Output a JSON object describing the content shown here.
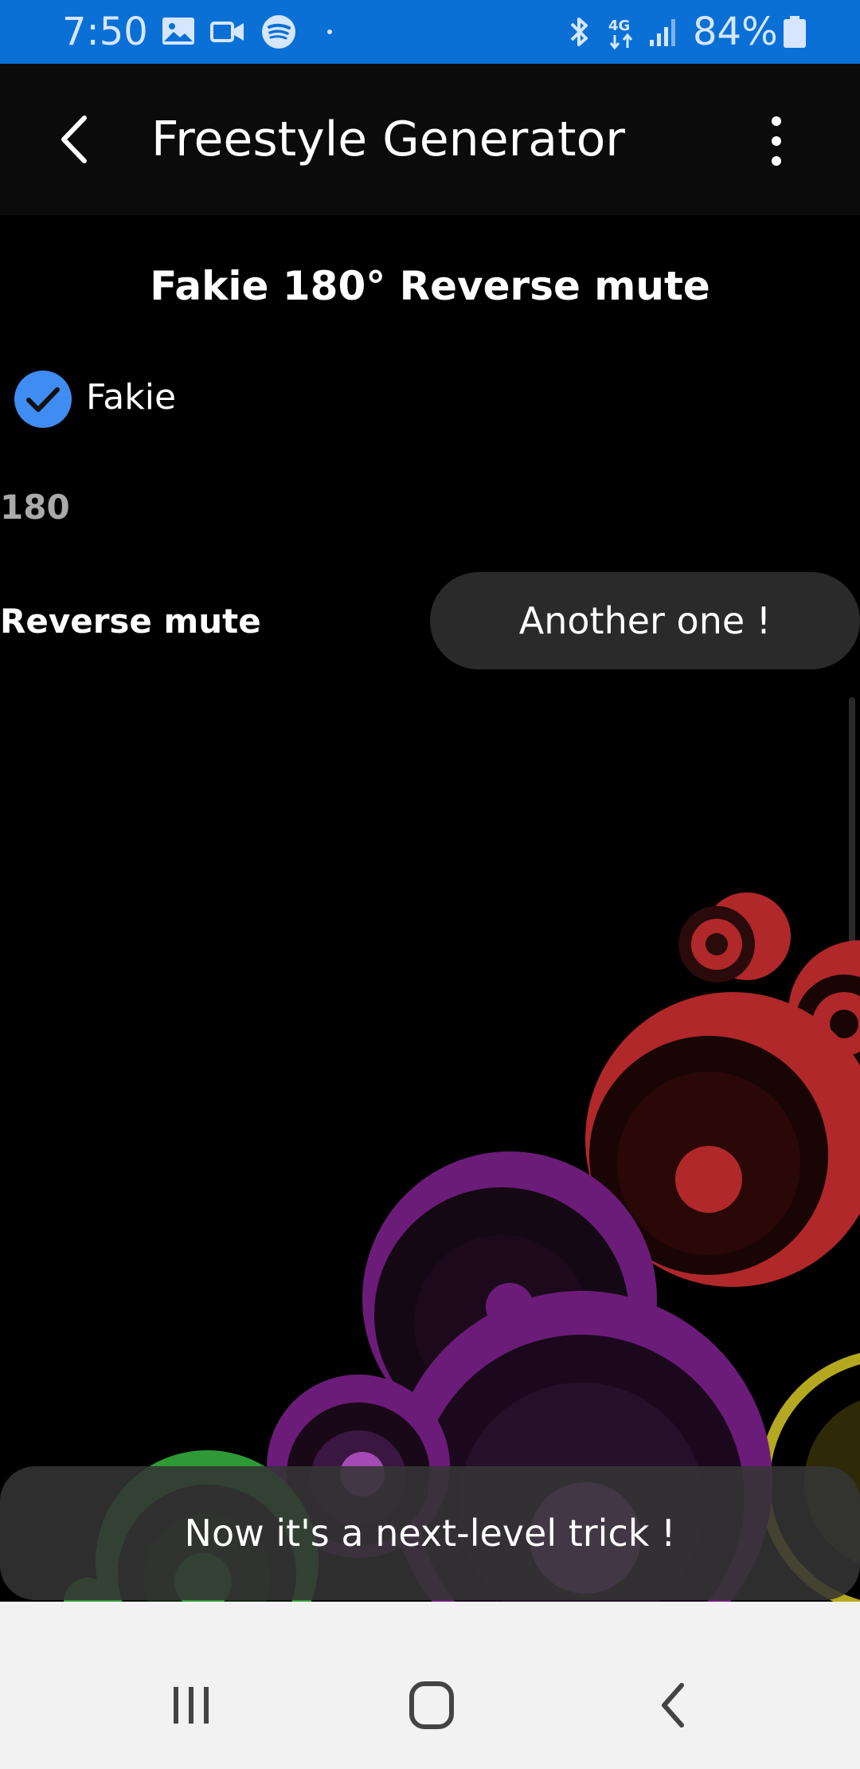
{
  "status_bar": {
    "time": "7:50",
    "battery": "84%",
    "network": "4G",
    "left_icons": [
      "gallery-icon",
      "video-icon",
      "spotify-icon",
      "dot-icon"
    ],
    "right_icons": [
      "bluetooth-icon",
      "network-4g-icon",
      "signal-icon",
      "battery-icon"
    ],
    "background_color": "#0a70d6"
  },
  "app_bar": {
    "title": "Freestyle Generator",
    "back_icon": "back-arrow-icon",
    "menu_icon": "more-vert-icon"
  },
  "trick": {
    "full_name": "Fakie 180° Reverse mute",
    "stance_label": "Fakie",
    "stance_checked": true,
    "rotation": "180",
    "grab": "Reverse mute"
  },
  "buttons": {
    "another_label": "Another one !"
  },
  "toast": {
    "message": "Now it's a next-level trick !"
  },
  "nav_bar": {
    "icons": [
      "recents-icon",
      "home-icon",
      "back-icon"
    ]
  },
  "colors": {
    "accent": "#3f8cf2",
    "button_bg": "#2a2a2a",
    "art_red": "#b0282a",
    "art_purple": "#6b1c78",
    "art_green": "#2f9a35",
    "art_yellow": "#b5a821"
  }
}
